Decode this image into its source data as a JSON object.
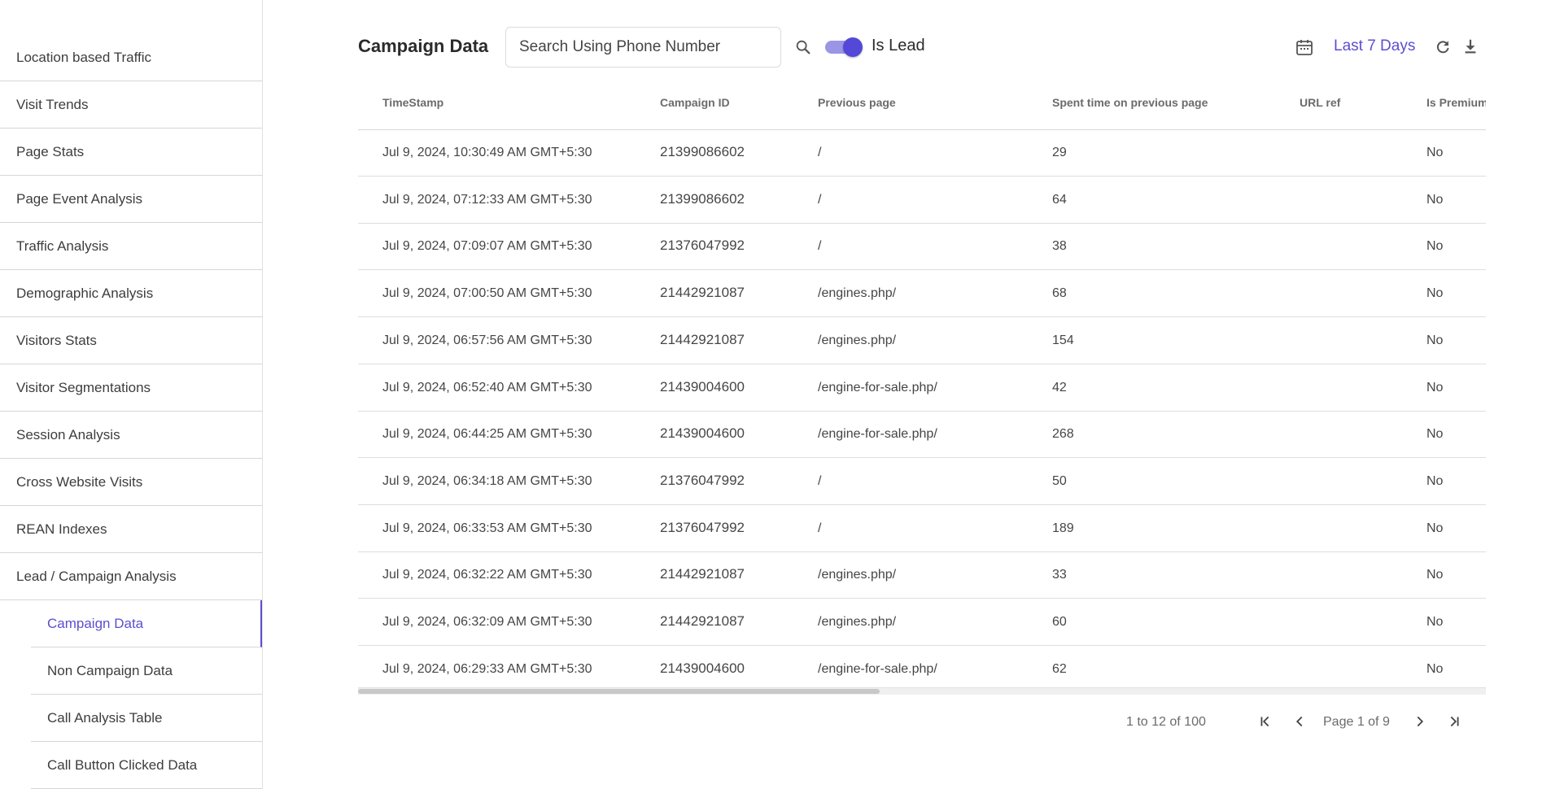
{
  "sidebar": {
    "items": [
      {
        "label": "Location based Traffic"
      },
      {
        "label": "Visit Trends"
      },
      {
        "label": "Page Stats"
      },
      {
        "label": "Page Event Analysis"
      },
      {
        "label": "Traffic Analysis"
      },
      {
        "label": "Demographic Analysis"
      },
      {
        "label": "Visitors Stats"
      },
      {
        "label": "Visitor Segmentations"
      },
      {
        "label": "Session Analysis"
      },
      {
        "label": "Cross Website Visits"
      },
      {
        "label": "REAN Indexes"
      },
      {
        "label": "Lead / Campaign Analysis"
      }
    ],
    "subitems": [
      {
        "label": "Campaign Data",
        "active": true
      },
      {
        "label": "Non Campaign Data"
      },
      {
        "label": "Call Analysis Table"
      },
      {
        "label": "Call Button Clicked Data"
      }
    ]
  },
  "toolbar": {
    "title": "Campaign Data",
    "search_placeholder": "Search Using Phone Number",
    "search_icon": "search-icon",
    "toggle_label": "Is Lead",
    "toggle_on": true,
    "calendar_icon": "calendar-icon",
    "date_range": "Last 7 Days",
    "refresh_icon": "refresh-icon",
    "download_icon": "download-icon"
  },
  "table": {
    "columns": [
      "TimeStamp",
      "Campaign ID",
      "Previous page",
      "Spent time on previous page",
      "URL ref",
      "Is Premium"
    ],
    "rows": [
      [
        "Jul 9, 2024, 10:30:49 AM GMT+5:30",
        "21399086602",
        "/",
        "29",
        "",
        "No"
      ],
      [
        "Jul 9, 2024, 07:12:33 AM GMT+5:30",
        "21399086602",
        "/",
        "64",
        "",
        "No"
      ],
      [
        "Jul 9, 2024, 07:09:07 AM GMT+5:30",
        "21376047992",
        "/",
        "38",
        "",
        "No"
      ],
      [
        "Jul 9, 2024, 07:00:50 AM GMT+5:30",
        "21442921087",
        "/engines.php/",
        "68",
        "",
        "No"
      ],
      [
        "Jul 9, 2024, 06:57:56 AM GMT+5:30",
        "21442921087",
        "/engines.php/",
        "154",
        "",
        "No"
      ],
      [
        "Jul 9, 2024, 06:52:40 AM GMT+5:30",
        "21439004600",
        "/engine-for-sale.php/",
        "42",
        "",
        "No"
      ],
      [
        "Jul 9, 2024, 06:44:25 AM GMT+5:30",
        "21439004600",
        "/engine-for-sale.php/",
        "268",
        "",
        "No"
      ],
      [
        "Jul 9, 2024, 06:34:18 AM GMT+5:30",
        "21376047992",
        "/",
        "50",
        "",
        "No"
      ],
      [
        "Jul 9, 2024, 06:33:53 AM GMT+5:30",
        "21376047992",
        "/",
        "189",
        "",
        "No"
      ],
      [
        "Jul 9, 2024, 06:32:22 AM GMT+5:30",
        "21442921087",
        "/engines.php/",
        "33",
        "",
        "No"
      ],
      [
        "Jul 9, 2024, 06:32:09 AM GMT+5:30",
        "21442921087",
        "/engines.php/",
        "60",
        "",
        "No"
      ],
      [
        "Jul 9, 2024, 06:29:33 AM GMT+5:30",
        "21439004600",
        "/engine-for-sale.php/",
        "62",
        "",
        "No"
      ]
    ]
  },
  "pagination": {
    "summary": "1 to 12 of 100",
    "page_label": "Page 1 of 9"
  },
  "colors": {
    "accent": "#5a4fcf",
    "toggle_track": "#9b95e6",
    "toggle_knob": "#5448d8"
  }
}
